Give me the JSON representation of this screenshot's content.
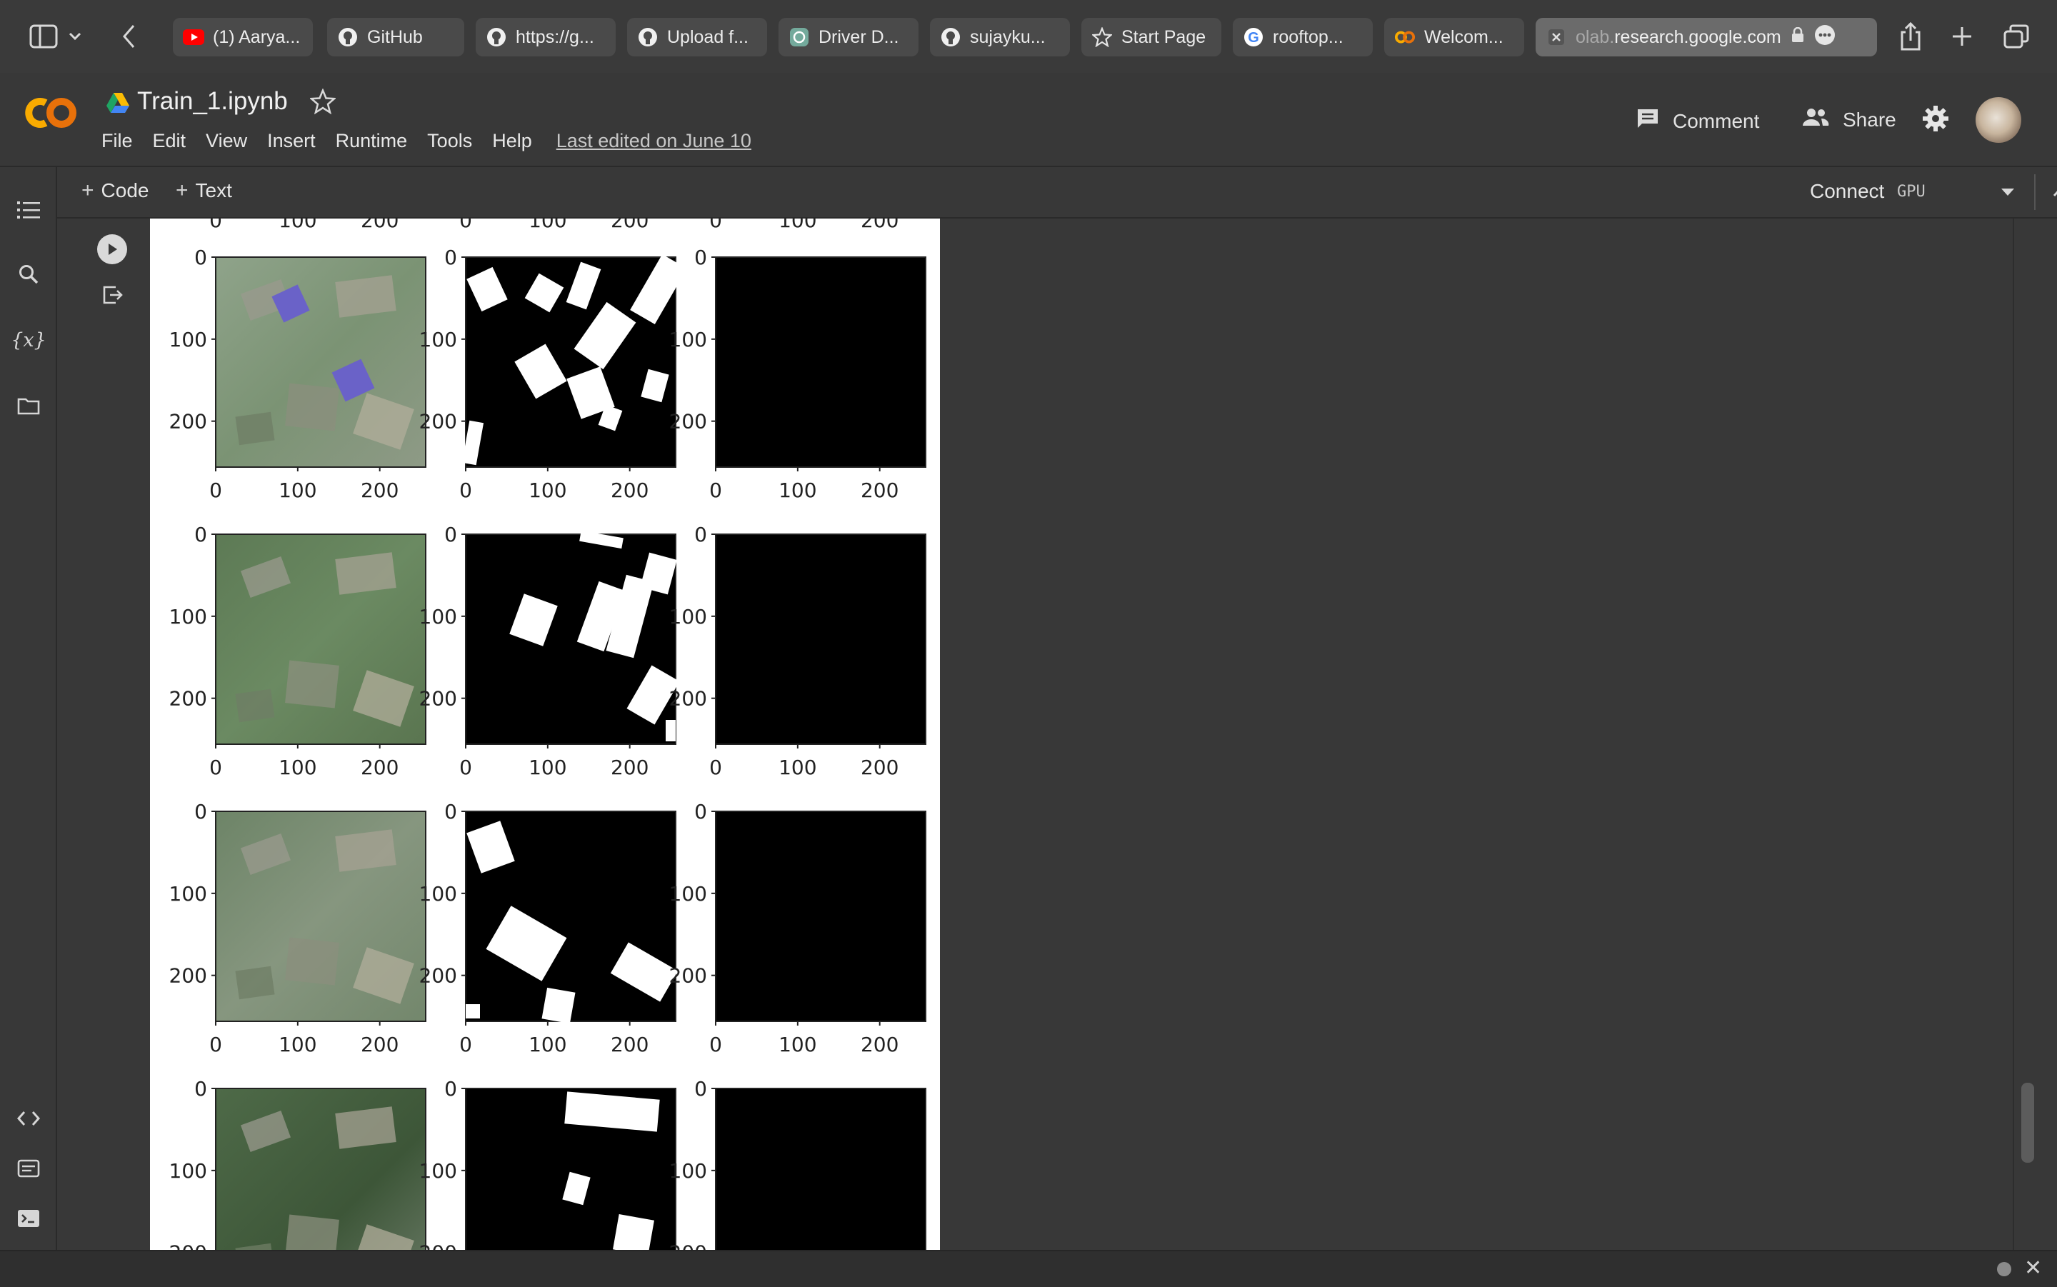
{
  "browser": {
    "tabs": [
      {
        "label": "(1) Aarya...",
        "icon": "youtube-icon"
      },
      {
        "label": "GitHub",
        "icon": "github-icon"
      },
      {
        "label": "https://g...",
        "icon": "github-icon"
      },
      {
        "label": "Upload f...",
        "icon": "github-icon"
      },
      {
        "label": "Driver D...",
        "icon": "chatgpt-icon"
      },
      {
        "label": "sujayku...",
        "icon": "github-icon"
      },
      {
        "label": "Start Page",
        "icon": "star-icon"
      },
      {
        "label": "rooftop...",
        "icon": "google-icon"
      },
      {
        "label": "Welcom...",
        "icon": "colab-icon"
      }
    ],
    "active_tab": {
      "url_dim": "olab.",
      "url": "research.google.com",
      "icon": "close-icon"
    }
  },
  "header": {
    "title": "Train_1.ipynb",
    "menu": [
      "File",
      "Edit",
      "View",
      "Insert",
      "Runtime",
      "Tools",
      "Help"
    ],
    "last_edited": "Last edited on June 10",
    "comment_label": "Comment",
    "share_label": "Share"
  },
  "toolbar": {
    "code_label": "Code",
    "text_label": "Text",
    "connect_label": "Connect",
    "runtime_label": "GPU"
  },
  "figure": {
    "rows": 4,
    "columns": [
      "image",
      "mask",
      "prediction"
    ],
    "y_ticks": [
      "0",
      "100",
      "200"
    ],
    "x_ticks": [
      "0",
      "100",
      "200"
    ],
    "top_row_partial_ticks": [
      "0",
      "100",
      "200"
    ]
  },
  "colors": {
    "background": "#383838",
    "output_bg": "#ffffff",
    "accent_logo": "#f9ab00"
  }
}
